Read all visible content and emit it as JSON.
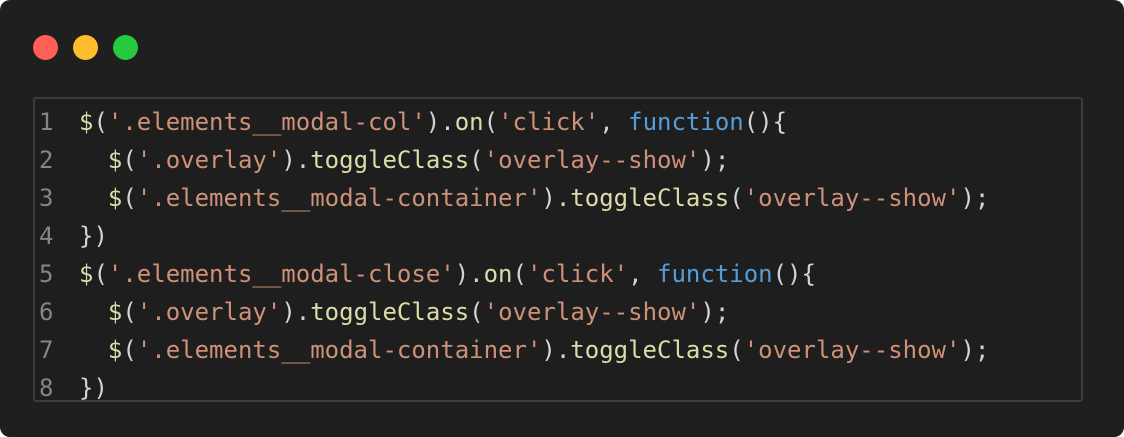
{
  "window": {
    "traffic_lights": [
      {
        "name": "close",
        "color": "#ff5f56"
      },
      {
        "name": "minimize",
        "color": "#ffbd2e"
      },
      {
        "name": "maximize",
        "color": "#27c93f"
      }
    ]
  },
  "editor": {
    "lines": [
      {
        "number": "1",
        "tokens": [
          {
            "t": "fn",
            "v": "$"
          },
          {
            "t": "punc",
            "v": "("
          },
          {
            "t": "str",
            "v": "'.elements__modal-col'"
          },
          {
            "t": "punc",
            "v": ")."
          },
          {
            "t": "fn",
            "v": "on"
          },
          {
            "t": "punc",
            "v": "("
          },
          {
            "t": "str",
            "v": "'click'"
          },
          {
            "t": "punc",
            "v": ", "
          },
          {
            "t": "kw",
            "v": "function"
          },
          {
            "t": "punc",
            "v": "(){"
          }
        ]
      },
      {
        "number": "2",
        "tokens": [
          {
            "t": "punc",
            "v": "  "
          },
          {
            "t": "fn",
            "v": "$"
          },
          {
            "t": "punc",
            "v": "("
          },
          {
            "t": "str",
            "v": "'.overlay'"
          },
          {
            "t": "punc",
            "v": ")."
          },
          {
            "t": "fn",
            "v": "toggleClass"
          },
          {
            "t": "punc",
            "v": "("
          },
          {
            "t": "str",
            "v": "'overlay--show'"
          },
          {
            "t": "punc",
            "v": ");"
          }
        ]
      },
      {
        "number": "3",
        "tokens": [
          {
            "t": "punc",
            "v": "  "
          },
          {
            "t": "fn",
            "v": "$"
          },
          {
            "t": "punc",
            "v": "("
          },
          {
            "t": "str",
            "v": "'.elements__modal-container'"
          },
          {
            "t": "punc",
            "v": ")."
          },
          {
            "t": "fn",
            "v": "toggleClass"
          },
          {
            "t": "punc",
            "v": "("
          },
          {
            "t": "str",
            "v": "'overlay--show'"
          },
          {
            "t": "punc",
            "v": ");"
          }
        ]
      },
      {
        "number": "4",
        "tokens": [
          {
            "t": "punc",
            "v": "})"
          }
        ]
      },
      {
        "number": "5",
        "tokens": [
          {
            "t": "fn",
            "v": "$"
          },
          {
            "t": "punc",
            "v": "("
          },
          {
            "t": "str",
            "v": "'.elements__modal-close'"
          },
          {
            "t": "punc",
            "v": ")."
          },
          {
            "t": "fn",
            "v": "on"
          },
          {
            "t": "punc",
            "v": "("
          },
          {
            "t": "str",
            "v": "'click'"
          },
          {
            "t": "punc",
            "v": ", "
          },
          {
            "t": "kw",
            "v": "function"
          },
          {
            "t": "punc",
            "v": "(){"
          }
        ]
      },
      {
        "number": "6",
        "tokens": [
          {
            "t": "punc",
            "v": "  "
          },
          {
            "t": "fn",
            "v": "$"
          },
          {
            "t": "punc",
            "v": "("
          },
          {
            "t": "str",
            "v": "'.overlay'"
          },
          {
            "t": "punc",
            "v": ")."
          },
          {
            "t": "fn",
            "v": "toggleClass"
          },
          {
            "t": "punc",
            "v": "("
          },
          {
            "t": "str",
            "v": "'overlay--show'"
          },
          {
            "t": "punc",
            "v": ");"
          }
        ]
      },
      {
        "number": "7",
        "tokens": [
          {
            "t": "punc",
            "v": "  "
          },
          {
            "t": "fn",
            "v": "$"
          },
          {
            "t": "punc",
            "v": "("
          },
          {
            "t": "str",
            "v": "'.elements__modal-container'"
          },
          {
            "t": "punc",
            "v": ")."
          },
          {
            "t": "fn",
            "v": "toggleClass"
          },
          {
            "t": "punc",
            "v": "("
          },
          {
            "t": "str",
            "v": "'overlay--show'"
          },
          {
            "t": "punc",
            "v": ");"
          }
        ]
      },
      {
        "number": "8",
        "tokens": [
          {
            "t": "punc",
            "v": "})"
          }
        ]
      }
    ]
  }
}
